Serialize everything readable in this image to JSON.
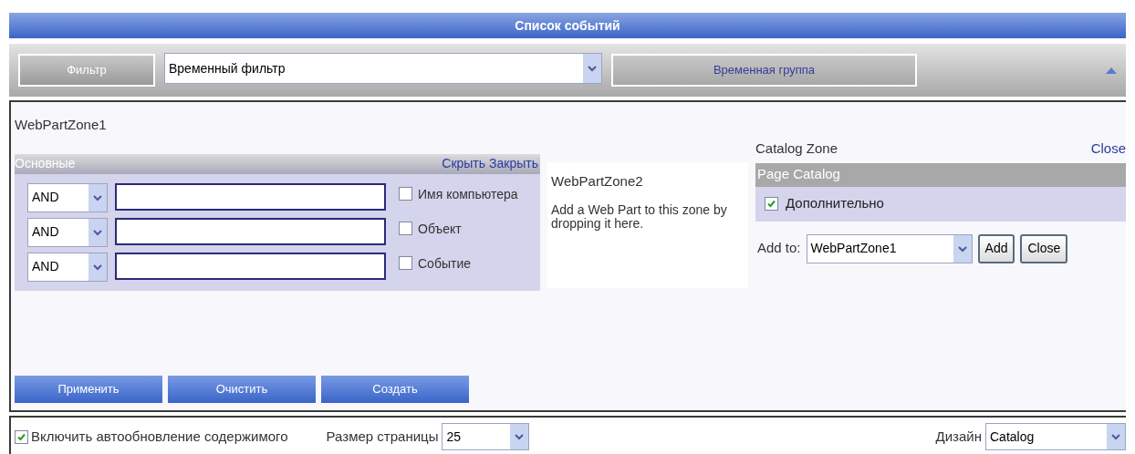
{
  "title": "Список событий",
  "toolbar": {
    "filter_button": "Фильтр",
    "filter_select": "Временный фильтр",
    "group_button": "Временная группа"
  },
  "zone1": {
    "title": "WebPartZone1",
    "part_title": "Основные",
    "links": [
      "Скрыть",
      "Закрыть"
    ],
    "rows": [
      {
        "operator": "AND",
        "label": "Имя компьютера",
        "checked": false
      },
      {
        "operator": "AND",
        "label": "Объект",
        "checked": false
      },
      {
        "operator": "AND",
        "label": "Событие",
        "checked": false
      }
    ],
    "buttons": [
      "Применить",
      "Очистить",
      "Создать"
    ]
  },
  "zone2": {
    "title": "WebPartZone2",
    "hint": "Add a Web Part to this zone by dropping it here."
  },
  "catalog": {
    "title": "Catalog Zone",
    "close_link": "Close",
    "catalog_title": "Page Catalog",
    "items": [
      {
        "label": "Дополнительно",
        "checked": true
      }
    ],
    "add_to_label": "Add to:",
    "add_to_value": "WebPartZone1",
    "buttons": [
      "Add",
      "Close"
    ]
  },
  "footer": {
    "autorefresh": {
      "label": "Включить автообновление содержимого",
      "checked": true
    },
    "page_size_label": "Размер страницы",
    "page_size": "25",
    "design_label": "Дизайн",
    "design": "Catalog"
  }
}
